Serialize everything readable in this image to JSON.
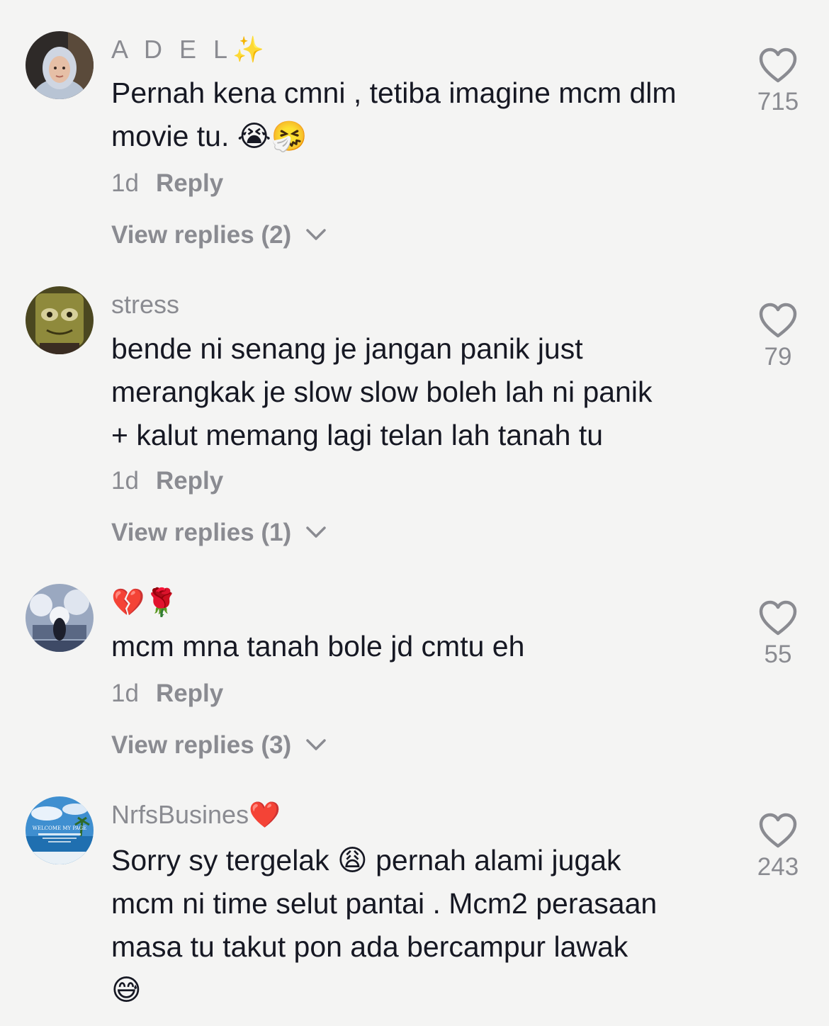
{
  "comments": [
    {
      "username": "A D E L",
      "username_emoji": "✨",
      "text_lines": [
        "Pernah kena cmni , tetiba imagine mcm dlm",
        "movie tu. 😭🤧"
      ],
      "time": "1d",
      "reply_label": "Reply",
      "view_replies": "View replies (2)",
      "likes": "715"
    },
    {
      "username": "stress",
      "username_emoji": "",
      "text_lines": [
        "bende ni senang je jangan panik just",
        "merangkak je slow slow boleh lah ni panik",
        "+ kalut memang lagi telan lah tanah tu"
      ],
      "time": "1d",
      "reply_label": "Reply",
      "view_replies": "View replies (1)",
      "likes": "79"
    },
    {
      "username": "",
      "username_emoji": "💔🌹",
      "text_lines": [
        "mcm mna tanah bole jd cmtu eh"
      ],
      "time": "1d",
      "reply_label": "Reply",
      "view_replies": "View replies (3)",
      "likes": "55"
    },
    {
      "username": "NrfsBusines",
      "username_emoji": "❤️",
      "text_lines": [
        "Sorry sy tergelak 😩 pernah alami jugak",
        "mcm ni time selut pantai . Mcm2 perasaan",
        "masa tu takut pon ada bercampur lawak",
        "😅"
      ],
      "likes": "243",
      "avatar_banner": "WELCOME MY PAGE"
    }
  ],
  "colors": {
    "background": "#f4f4f3",
    "text": "#161823",
    "muted": "#8a8b91"
  },
  "icons": {
    "like": "heart-outline-icon",
    "expand": "chevron-down-icon"
  }
}
